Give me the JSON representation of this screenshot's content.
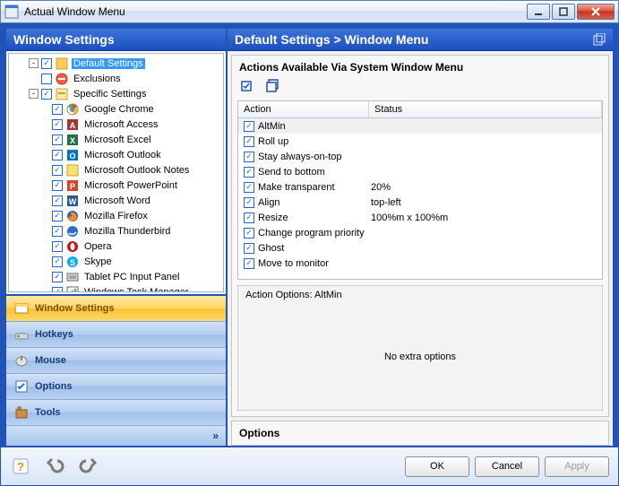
{
  "window": {
    "title": "Actual Window Menu"
  },
  "left": {
    "header": "Window Settings",
    "tree": [
      {
        "label": "Default Settings",
        "level": 1,
        "checked": true,
        "selected": true,
        "expander": "-",
        "icon": "settings"
      },
      {
        "label": "Exclusions",
        "level": 1,
        "checked": false,
        "icon": "exclusions"
      },
      {
        "label": "Specific Settings",
        "level": 1,
        "checked": true,
        "expander": "-",
        "icon": "specific"
      },
      {
        "label": "Google Chrome",
        "level": 2,
        "checked": true,
        "icon": "chrome"
      },
      {
        "label": "Microsoft Access",
        "level": 2,
        "checked": true,
        "icon": "access"
      },
      {
        "label": "Microsoft Excel",
        "level": 2,
        "checked": true,
        "icon": "excel"
      },
      {
        "label": "Microsoft Outlook",
        "level": 2,
        "checked": true,
        "icon": "outlook"
      },
      {
        "label": "Microsoft Outlook Notes",
        "level": 2,
        "checked": true,
        "icon": "outlooknotes"
      },
      {
        "label": "Microsoft PowerPoint",
        "level": 2,
        "checked": true,
        "icon": "powerpoint"
      },
      {
        "label": "Microsoft Word",
        "level": 2,
        "checked": true,
        "icon": "word"
      },
      {
        "label": "Mozilla Firefox",
        "level": 2,
        "checked": true,
        "icon": "firefox"
      },
      {
        "label": "Mozilla Thunderbird",
        "level": 2,
        "checked": true,
        "icon": "thunderbird"
      },
      {
        "label": "Opera",
        "level": 2,
        "checked": true,
        "icon": "opera"
      },
      {
        "label": "Skype",
        "level": 2,
        "checked": true,
        "icon": "skype"
      },
      {
        "label": "Tablet PC Input Panel",
        "level": 2,
        "checked": true,
        "icon": "tablet"
      },
      {
        "label": "Windows Task Manager",
        "level": 2,
        "checked": true,
        "icon": "taskmgr"
      }
    ],
    "nav": [
      {
        "label": "Window Settings",
        "active": true
      },
      {
        "label": "Hotkeys",
        "active": false
      },
      {
        "label": "Mouse",
        "active": false
      },
      {
        "label": "Options",
        "active": false
      },
      {
        "label": "Tools",
        "active": false
      }
    ],
    "nav_footer_glyph": "»"
  },
  "right": {
    "breadcrumb": "Default Settings > Window Menu",
    "group_title": "Actions Available Via System Window Menu",
    "columns": {
      "action": "Action",
      "status": "Status"
    },
    "rows": [
      {
        "action": "AltMin",
        "status": "",
        "checked": true,
        "selected": true
      },
      {
        "action": "Roll up",
        "status": "",
        "checked": true
      },
      {
        "action": "Stay always-on-top",
        "status": "",
        "checked": true
      },
      {
        "action": "Send to bottom",
        "status": "",
        "checked": true
      },
      {
        "action": "Make transparent",
        "status": "20%",
        "checked": true
      },
      {
        "action": "Align",
        "status": "top-left",
        "checked": true
      },
      {
        "action": "Resize",
        "status": "100%m x 100%m",
        "checked": true
      },
      {
        "action": "Change program priority",
        "status": "",
        "checked": true
      },
      {
        "action": "Ghost",
        "status": "",
        "checked": true
      },
      {
        "action": "Move to monitor",
        "status": "",
        "checked": true
      }
    ],
    "action_options_label": "Action Options: AltMin",
    "no_extra_options": "No extra options",
    "options_header": "Options"
  },
  "buttons": {
    "ok": "OK",
    "cancel": "Cancel",
    "apply": "Apply"
  }
}
